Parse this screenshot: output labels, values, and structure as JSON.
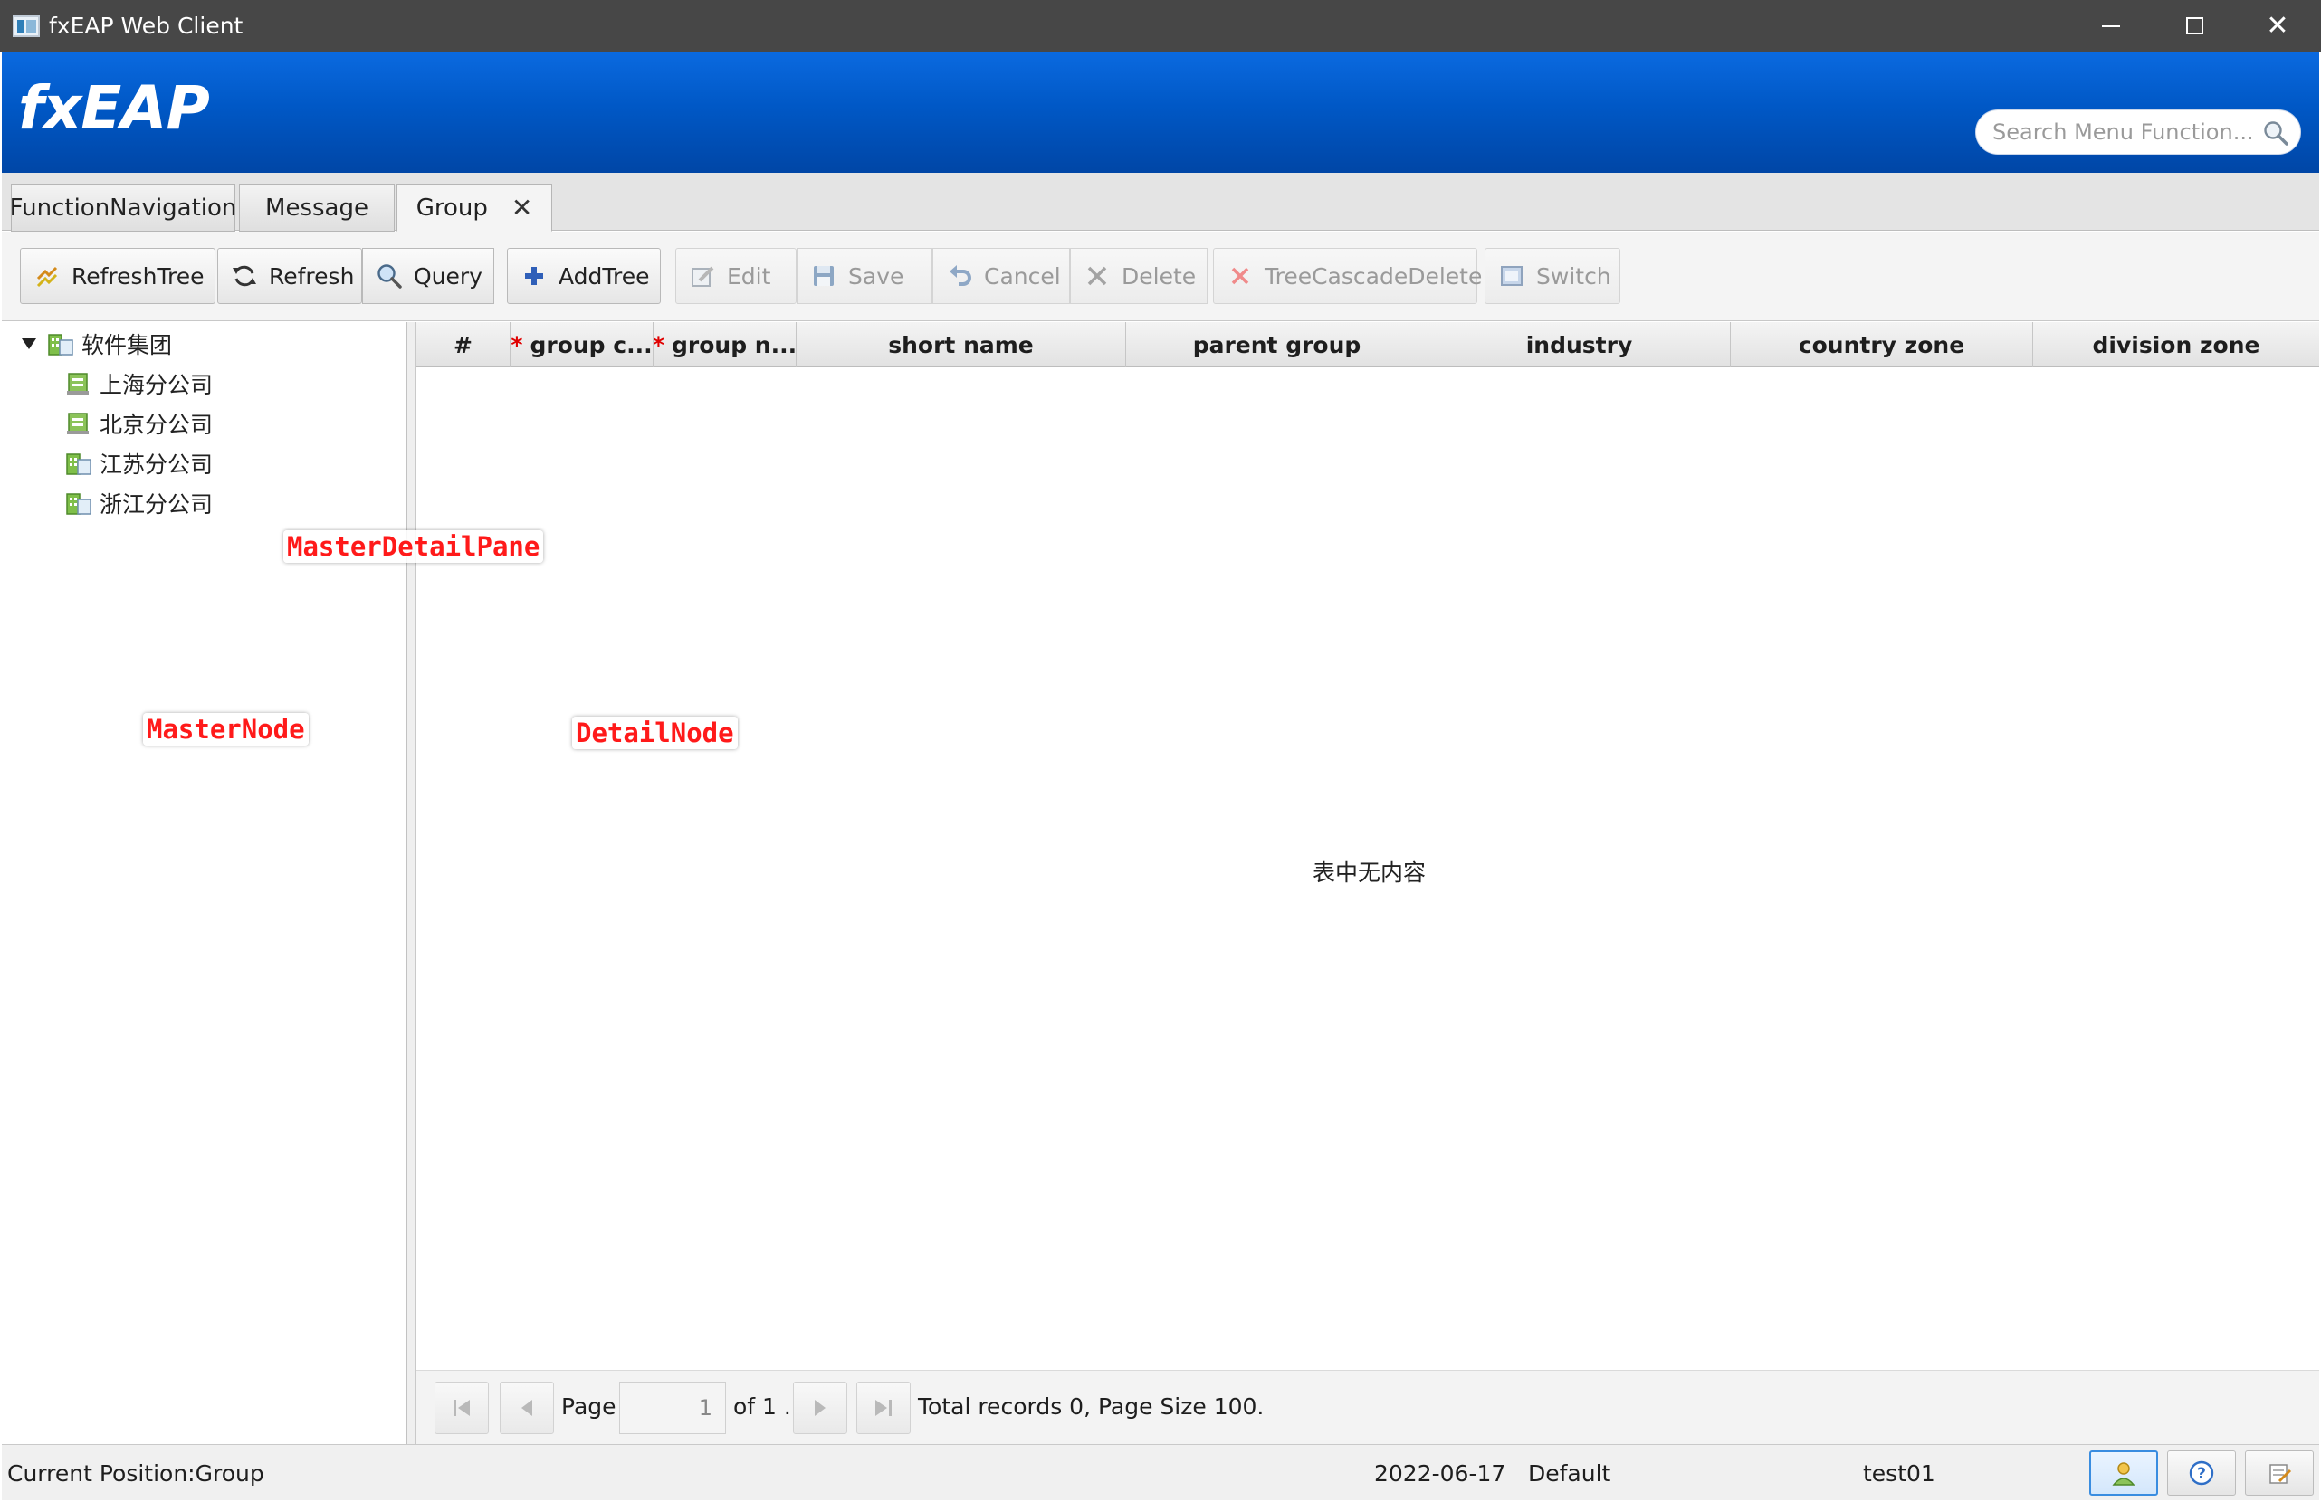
{
  "window": {
    "title": "fxEAP Web Client"
  },
  "header": {
    "logo": "fxEAP",
    "search_placeholder": "Search Menu Function..."
  },
  "tabs": [
    {
      "label": "FunctionNavigation"
    },
    {
      "label": "Message"
    },
    {
      "label": "Group",
      "closable": true,
      "active": true
    }
  ],
  "toolbar": {
    "refresh_tree": "RefreshTree",
    "refresh": "Refresh",
    "query": "Query",
    "add_tree": "AddTree",
    "edit": "Edit",
    "save": "Save",
    "cancel": "Cancel",
    "delete": "Delete",
    "tree_cascade_delete": "TreeCascadeDelete",
    "switch": "Switch"
  },
  "tree": {
    "root": "软件集团",
    "children": [
      "上海分公司",
      "北京分公司",
      "江苏分公司",
      "浙江分公司"
    ]
  },
  "table": {
    "columns": [
      "#",
      "group c...",
      "group n...",
      "short name",
      "parent group",
      "industry",
      "country zone",
      "division zone"
    ],
    "required_marker": "*",
    "empty_message": "表中无内容"
  },
  "pager": {
    "page_label": "Page",
    "page_value": "1",
    "of_label": "of 1 .",
    "summary": "Total records  0, Page Size 100."
  },
  "status": {
    "position": "Current Position:Group",
    "date": "2022-06-17",
    "theme": "Default",
    "user": "test01"
  },
  "annotations": {
    "master_detail_pane": "MasterDetailPane",
    "master_node": "MasterNode",
    "detail_node": "DetailNode"
  },
  "colors": {
    "header_blue": "#0058c6",
    "title_bar": "#474747",
    "annotation_red": "#ff1a1a",
    "required_red": "#e00000"
  }
}
